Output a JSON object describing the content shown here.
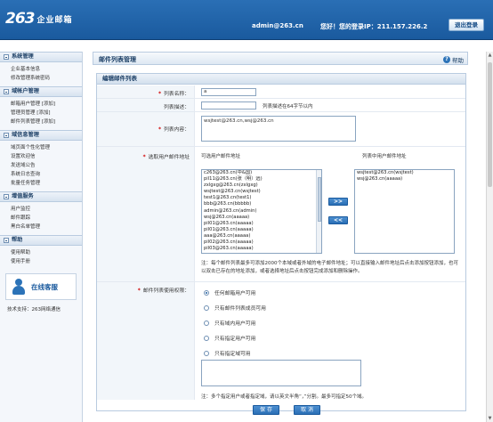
{
  "header": {
    "logo_mark": "263",
    "logo_text": "企业邮箱",
    "user": "admin@263.cn",
    "welcome": "您好！您的登录IP：211.157.226.2",
    "logout": "退出登录"
  },
  "sidebar": {
    "sections": [
      {
        "title": "系统管理",
        "items": [
          "企业基本信息",
          "修改管理系统密码"
        ]
      },
      {
        "title": "域帐户管理",
        "items": [
          "邮箱用户管理 [添加]",
          "管理员管理 [添加]",
          "邮件列表管理 [添加]"
        ]
      },
      {
        "title": "域信息管理",
        "items": [
          "域页面个性化管理",
          "设置欢迎信",
          "发送域公告",
          "系统日志查询",
          "批量任务管理"
        ]
      },
      {
        "title": "增值服务",
        "items": [
          "用户监控",
          "邮件跟踪",
          "黑白名单管理"
        ]
      },
      {
        "title": "帮助",
        "items": [
          "使用帮助",
          "使用手册"
        ]
      }
    ],
    "service_label": "在线客服",
    "tech_support": "技术支持：263网络通信"
  },
  "main": {
    "title": "邮件列表管理",
    "help": "帮助",
    "panel_title": "编辑邮件列表",
    "fields": {
      "name_label": "列表名称：",
      "name_value": "a",
      "desc_label": "列表描述：",
      "desc_value": "",
      "desc_hint": "列表描述在64字节以内",
      "content_label": "列表内容：",
      "content_value": "wsjtest@263.cn,wsj@263.cn",
      "select_label": "选取用户邮件地址",
      "avail_header": "可选用户邮件地址",
      "list_header": "列表中用户邮件地址",
      "move_right": ">>",
      "move_left": "<<",
      "note": "注：每个邮件列表最多可添加2000个本域或者外域的电子邮件地址；可以直接输入邮件地址后点击添加按钮添加，也可以双击已存在的地址添加，或者选择地址后点击按钮完成添加和删除操作。",
      "perm_label": "邮件列表使用权限：",
      "perm_note": "注：多个指定用户或者指定域，请以英文半角“，”分割。最多可指定50个域。"
    },
    "available": [
      "c263@263.cn(中&国)",
      "pil11@263.cn(张（明）远)",
      "zxlgxg@263.cn(zxlgxg)",
      "wsjtest@263.cn(wsjtest)",
      "test1@263.cn(test1)",
      "bbb@263.cn(bbbbb)",
      "admin@263.cn(admin)",
      "wsj@263.cn(aaaaa)",
      "pil01@263.cn(aaaaa)",
      "pil01@263.cn(aaaaa)",
      "aaa@263.cn(aaaaa)",
      "pil02@263.cn(aaaaa)",
      "pil03@263.cn(aaaaa)"
    ],
    "selected": [
      "wsjtest@263.cn(wsjtest)",
      "wsj@263.cn(aaaaa)"
    ],
    "permissions": [
      {
        "label": "任何邮箱用户可用",
        "checked": true
      },
      {
        "label": "只有邮件列表成员可用",
        "checked": false
      },
      {
        "label": "只有域内用户可用",
        "checked": false
      },
      {
        "label": "只有指定用户可用",
        "checked": false
      },
      {
        "label": "只有指定域可用",
        "checked": false
      }
    ],
    "save": "保 存",
    "cancel": "取 消"
  },
  "colors": {
    "brand": "#1a5a9e",
    "required": "#d10000"
  }
}
